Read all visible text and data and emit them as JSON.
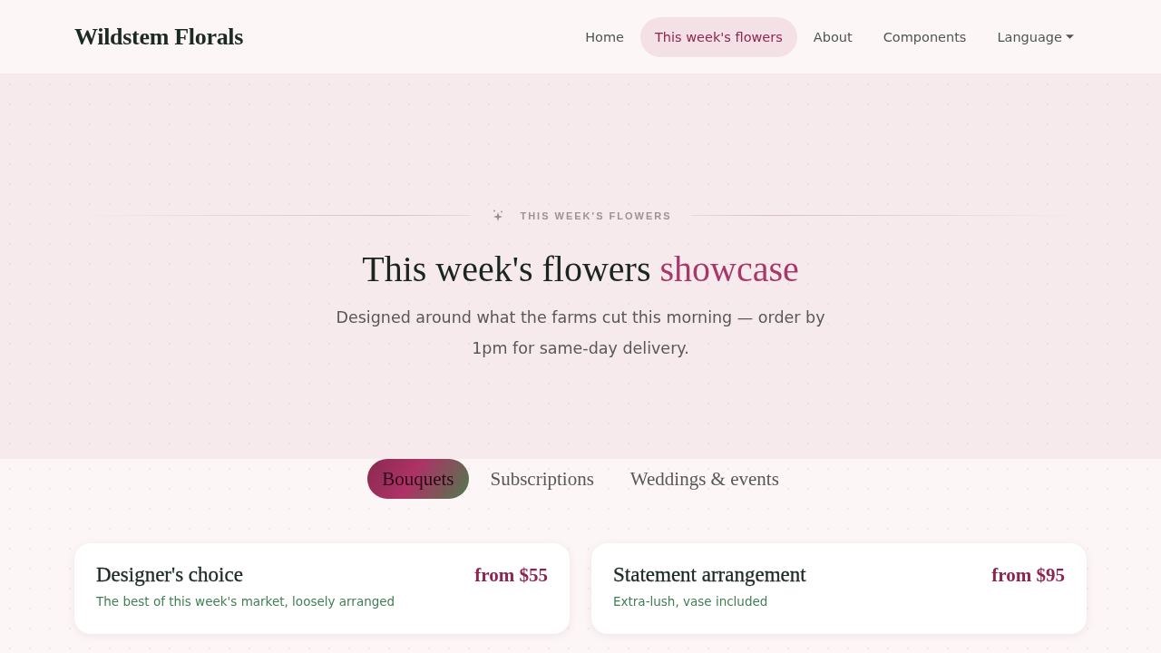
{
  "brand": "Wildstem Florals",
  "nav": [
    {
      "label": "Home",
      "kind": "link",
      "selected": false
    },
    {
      "label": "This week's flowers",
      "kind": "link",
      "selected": true
    },
    {
      "label": "About",
      "kind": "link",
      "selected": false
    },
    {
      "label": "Components",
      "kind": "link",
      "selected": false
    },
    {
      "label": "Language",
      "kind": "dropdown",
      "selected": false
    }
  ],
  "hero": {
    "eyebrow": "THIS WEEK'S FLOWERS",
    "title": "This week's flowers",
    "title_accent": "showcase",
    "subtitle": "Designed around what the farms cut this morning — order by 1pm for same-day delivery."
  },
  "tabs": [
    {
      "label": "Bouquets",
      "selected": true
    },
    {
      "label": "Subscriptions",
      "selected": false
    },
    {
      "label": "Weddings & events",
      "selected": false
    }
  ],
  "cards": [
    {
      "title": "Designer's choice",
      "description": "The best of this week's market, loosely arranged",
      "price": "from $55"
    },
    {
      "title": "Statement arrangement",
      "description": "Extra-lush, vase included",
      "price": "from $95"
    }
  ]
}
